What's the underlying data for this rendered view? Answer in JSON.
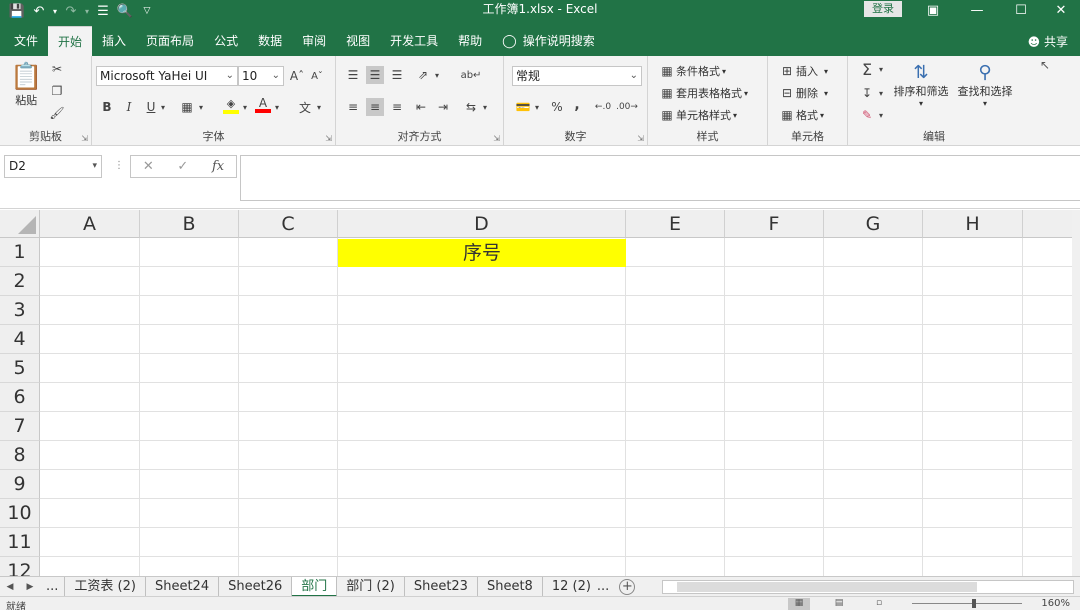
{
  "window": {
    "title": "工作簿1.xlsx  -  Excel",
    "login_label": "登录",
    "share_label": "共享"
  },
  "ribbon_tabs": [
    {
      "label": "文件",
      "active": false
    },
    {
      "label": "开始",
      "active": true
    },
    {
      "label": "插入",
      "active": false
    },
    {
      "label": "页面布局",
      "active": false
    },
    {
      "label": "公式",
      "active": false
    },
    {
      "label": "数据",
      "active": false
    },
    {
      "label": "审阅",
      "active": false
    },
    {
      "label": "视图",
      "active": false
    },
    {
      "label": "开发工具",
      "active": false
    },
    {
      "label": "帮助",
      "active": false
    },
    {
      "label": "操作说明搜索",
      "active": false
    }
  ],
  "clipboard": {
    "paste_label": "粘贴",
    "group_label": "剪贴板"
  },
  "font": {
    "font_name": "Microsoft YaHei UI",
    "font_size": "10",
    "bold": "B",
    "italic": "I",
    "underline": "U",
    "font_color_glyph": "A",
    "group_label": "字体",
    "fill_color": "#ffff00",
    "font_color": "#ff0000"
  },
  "alignment": {
    "group_label": "对齐方式"
  },
  "number": {
    "format": "常规",
    "percent": "%",
    "comma": ",",
    "group_label": "数字"
  },
  "styles": {
    "conditional": "条件格式",
    "table_format": "套用表格格式",
    "cell_styles": "单元格样式",
    "group_label": "样式"
  },
  "cells": {
    "insert": "插入",
    "delete": "删除",
    "format": "格式",
    "group_label": "单元格"
  },
  "editing": {
    "sort_filter": "排序和筛选",
    "find_select": "查找和选择",
    "group_label": "编辑"
  },
  "formula_bar": {
    "name_box": "D2",
    "cancel": "✕",
    "confirm": "✓",
    "fx": "fx",
    "content": ""
  },
  "grid": {
    "columns": [
      "A",
      "B",
      "C",
      "D",
      "E",
      "F",
      "G",
      "H"
    ],
    "active_column": "D",
    "rows": [
      "1",
      "2",
      "3",
      "4",
      "5",
      "6",
      "7",
      "8",
      "9",
      "10",
      "11",
      "12"
    ],
    "cell_D1": "序号",
    "highlight_color": "#ffff00"
  },
  "sheet_tabs": {
    "ellipsis_left": "...",
    "tabs": [
      {
        "label": "工资表 (2)",
        "active": false
      },
      {
        "label": "Sheet24",
        "active": false
      },
      {
        "label": "Sheet26",
        "active": false
      },
      {
        "label": "部门",
        "active": true
      },
      {
        "label": "部门 (2)",
        "active": false
      },
      {
        "label": "Sheet23",
        "active": false
      },
      {
        "label": "Sheet8",
        "active": false
      },
      {
        "label": "12 (2)",
        "active": false
      }
    ],
    "ellipsis_right": "...",
    "add": "+"
  },
  "status": {
    "ready": "就绪",
    "zoom": "160%"
  },
  "colors": {
    "accent": "#217346"
  }
}
